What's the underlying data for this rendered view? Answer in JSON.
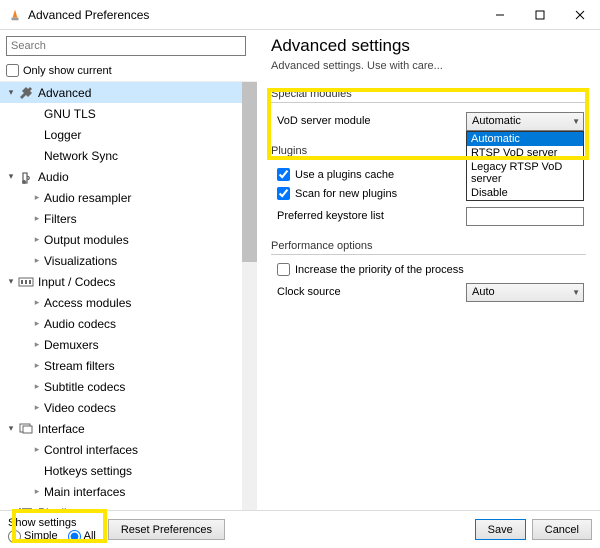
{
  "window": {
    "title": "Advanced Preferences"
  },
  "search": {
    "placeholder": "Search"
  },
  "only_show_current": "Only show current",
  "tree": {
    "advanced": {
      "label": "Advanced",
      "children": [
        "GNU TLS",
        "Logger",
        "Network Sync"
      ]
    },
    "audio": {
      "label": "Audio",
      "children": [
        "Audio resampler",
        "Filters",
        "Output modules",
        "Visualizations"
      ]
    },
    "input": {
      "label": "Input / Codecs",
      "children": [
        "Access modules",
        "Audio codecs",
        "Demuxers",
        "Stream filters",
        "Subtitle codecs",
        "Video codecs"
      ]
    },
    "interface": {
      "label": "Interface",
      "children": [
        "Control interfaces",
        "Hotkeys settings",
        "Main interfaces"
      ]
    },
    "playlist": {
      "label": "Playlist"
    }
  },
  "right": {
    "title": "Advanced settings",
    "hint": "Advanced settings. Use with care...",
    "sec_special": "Special modules",
    "vod_label": "VoD server module",
    "vod_value": "Automatic",
    "vod_options": [
      "Automatic",
      "RTSP VoD server",
      "Legacy RTSP VoD server",
      "Disable"
    ],
    "sec_plugins": "Plugins",
    "use_plugins_cache": "Use a plugins cache",
    "scan_new_plugins": "Scan for new plugins",
    "keystore_label": "Preferred keystore list",
    "sec_perf": "Performance options",
    "increase_priority": "Increase the priority of the process",
    "clock_label": "Clock source",
    "clock_value": "Auto"
  },
  "bottom": {
    "show_settings": "Show settings",
    "simple": "Simple",
    "all": "All",
    "reset": "Reset Preferences",
    "save": "Save",
    "cancel": "Cancel"
  }
}
